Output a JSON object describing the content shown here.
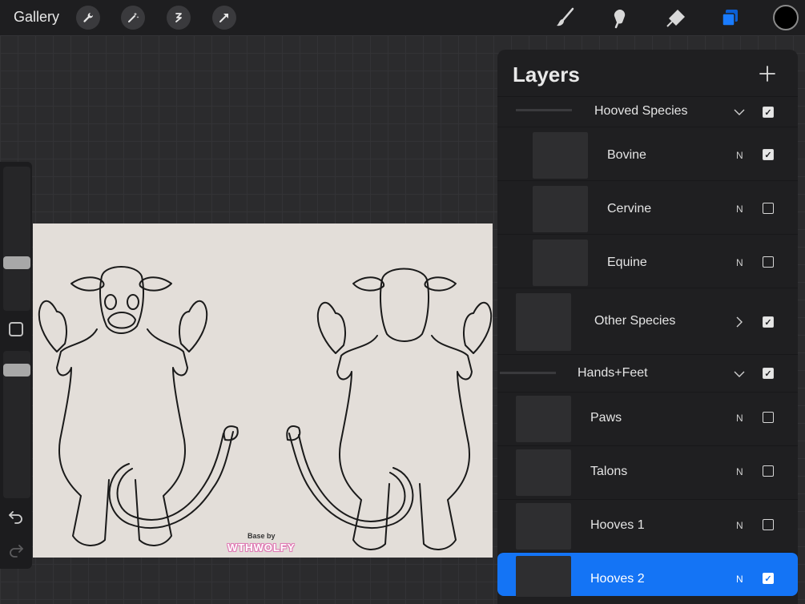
{
  "toolbar": {
    "gallery_label": "Gallery",
    "left_tools": [
      "wrench-icon",
      "magic-wand-icon",
      "selection-icon",
      "transform-arrow-icon"
    ],
    "right_tools": [
      "brush-icon",
      "smudge-icon",
      "eraser-icon",
      "layers-icon"
    ],
    "active_tool": "layers-icon",
    "color": "#000000",
    "accent": "#1474f5"
  },
  "canvas": {
    "watermark_small": "Base by",
    "watermark_large": "WTHWOLFY"
  },
  "layers": {
    "title": "Layers",
    "add_icon": "plus-icon",
    "rows": [
      {
        "kind": "group",
        "name": "Hooved Species",
        "expanded": true,
        "visible": true
      },
      {
        "kind": "layer",
        "name": "Bovine",
        "blend": "N",
        "visible": true
      },
      {
        "kind": "layer",
        "name": "Cervine",
        "blend": "N",
        "visible": false
      },
      {
        "kind": "layer",
        "name": "Equine",
        "blend": "N",
        "visible": false
      },
      {
        "kind": "group",
        "name": "Other Species",
        "expanded": false,
        "visible": true
      },
      {
        "kind": "group",
        "name": "Hands+Feet",
        "expanded": true,
        "visible": true
      },
      {
        "kind": "layer",
        "name": "Paws",
        "blend": "N",
        "visible": false
      },
      {
        "kind": "layer",
        "name": "Talons",
        "blend": "N",
        "visible": false
      },
      {
        "kind": "layer",
        "name": "Hooves 1",
        "blend": "N",
        "visible": false
      },
      {
        "kind": "layer",
        "name": "Hooves 2",
        "blend": "N",
        "visible": true,
        "selected": true
      }
    ]
  }
}
